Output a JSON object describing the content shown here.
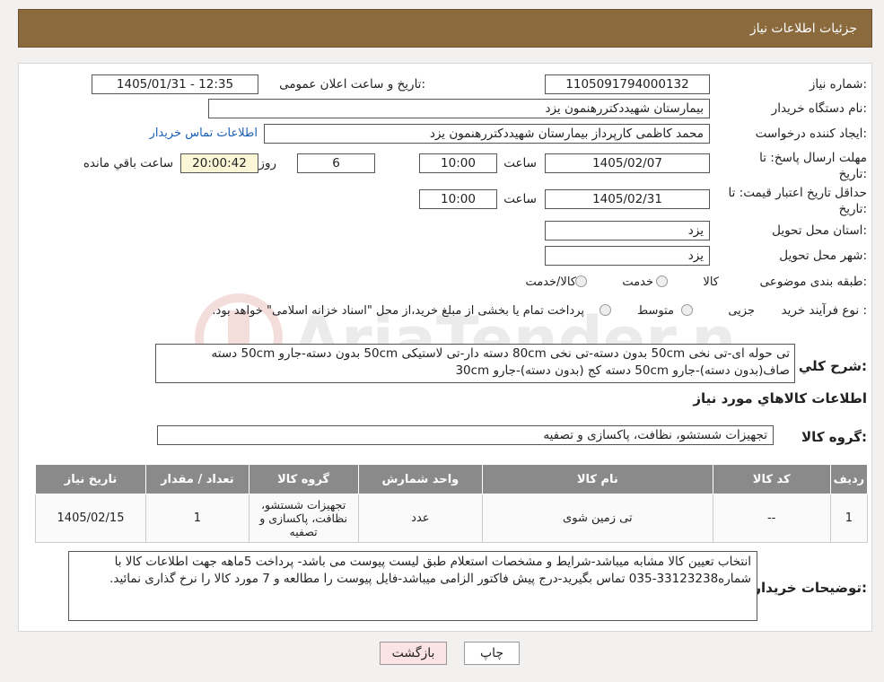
{
  "header": {
    "title": "جزئیات اطلاعات نیاز"
  },
  "form": {
    "need_number_label": "شماره نیاز:",
    "need_number": "1105091794000132",
    "announce_label": "تاریخ و ساعت اعلان عمومی:",
    "announce_value": "1405/01/31 - 12:35",
    "buyer_org_label": "نام دستگاه خریدار:",
    "buyer_org": "بیمارستان شهیددکتررهنمون یزد",
    "creator_label": "ایجاد کننده درخواست:",
    "creator": "محمد کاظمی کارپرداز بیمارستان شهیددکتررهنمون یزد",
    "contact_link": "اطلاعات تماس خریدار",
    "deadline_label_1": "مهلت ارسال پاسخ: تا",
    "deadline_label_2": "تاریخ:",
    "deadline_date": "1405/02/07",
    "time_label": "ساعت",
    "deadline_time": "10:00",
    "days_value": "6",
    "days_label": "روز و",
    "remaining_time": "20:00:42",
    "remaining_label": "ساعت باقي مانده",
    "validity_label_1": "حداقل تاریخ اعتبار قیمت: تا",
    "validity_label_2": "تاریخ:",
    "validity_date": "1405/02/31",
    "validity_time": "10:00",
    "province_label": "استان محل تحویل:",
    "province": "یزد",
    "city_label": "شهر محل تحویل:",
    "city": "یزد",
    "category_label": "طبقه بندی موضوعی:",
    "category_options": [
      "کالا",
      "خدمت",
      "کالا/خدمت"
    ],
    "process_label": "نوع فرآیند خرید :",
    "process_options": [
      "جزیی",
      "متوسط"
    ],
    "payment_note": "پرداخت تمام یا بخشی از مبلغ خرید،از محل \"اسناد خزانه اسلامی\" خواهد بود."
  },
  "summary": {
    "label": "شرح کلي نياز:",
    "text": "تی حوله ای-تی نخی 50cm بدون دسته-تی نخی 80cm دسته دار-تی لاستیکی 50cm بدون دسته-جارو 50cm دسته صاف(بدون دسته)-جارو 50cm دسته کج (بدون دسته)-جارو 30cm"
  },
  "goods_info_title": "اطلاعات کالاهاي مورد نياز",
  "goods_group": {
    "label": "گروه کالا:",
    "value": "تجهیزات شستشو، نظافت، پاکسازی و تصفیه"
  },
  "table": {
    "headers": [
      "ردیف",
      "کد کالا",
      "نام کالا",
      "واحد شمارش",
      "گروه کالا",
      "تعداد / مقدار",
      "تاریخ نیاز"
    ],
    "rows": [
      [
        "1",
        "--",
        "تی زمین شوی",
        "عدد",
        "تجهیزات شستشو، نظافت، پاکسازی و تصفیه",
        "1",
        "1405/02/15"
      ]
    ]
  },
  "notes": {
    "label": "توضیحات خریدار:",
    "text": "انتخاب تعیین کالا مشابه میباشد-شرایط و مشخصات استعلام طبق لیست پیوست می باشد- پرداخت 5ماهه جهت اطلاعات کالا با شماره33123238-035 تماس بگیرید-درج پیش فاکتور الزامی میباشد-فایل پیوست را مطالعه  و 7 مورد کالا را نرخ گذاری نمائید."
  },
  "buttons": {
    "print": "چاپ",
    "back": "بازگشت"
  },
  "colors": {
    "header": "#8b6a3e",
    "table_header": "#8a8a8a",
    "back_button": "#fbe3e3"
  }
}
